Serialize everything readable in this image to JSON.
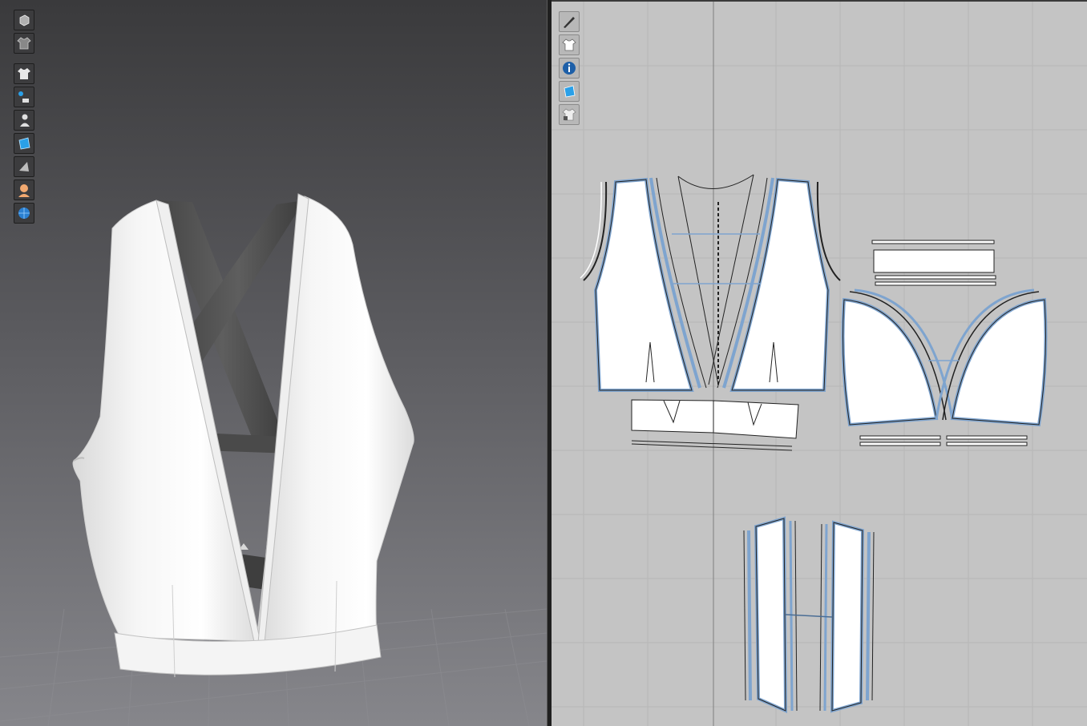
{
  "window": {
    "panels": [
      "3d-garment-view",
      "2d-pattern-view"
    ]
  },
  "toolbar_3d": {
    "icons": [
      "cube-icon",
      "garment-outline-icon",
      "show-garment-icon",
      "show-avatar-measure-icon",
      "show-avatar-icon",
      "texture-surface-icon",
      "shading-icon",
      "avatar-skin-icon",
      "globe-icon"
    ]
  },
  "toolbar_2d": {
    "icons": [
      "pen-tool-icon",
      "show-garment-2d-icon",
      "info-icon",
      "texture-2d-icon",
      "lock-pattern-icon"
    ]
  },
  "colors": {
    "viewport_top": "#3a3a3c",
    "viewport_bottom": "#86868b",
    "pattern_bg": "#c4c4c4",
    "seam_blue": "#7ea4cf",
    "accent_cyan": "#2aa0e8"
  }
}
